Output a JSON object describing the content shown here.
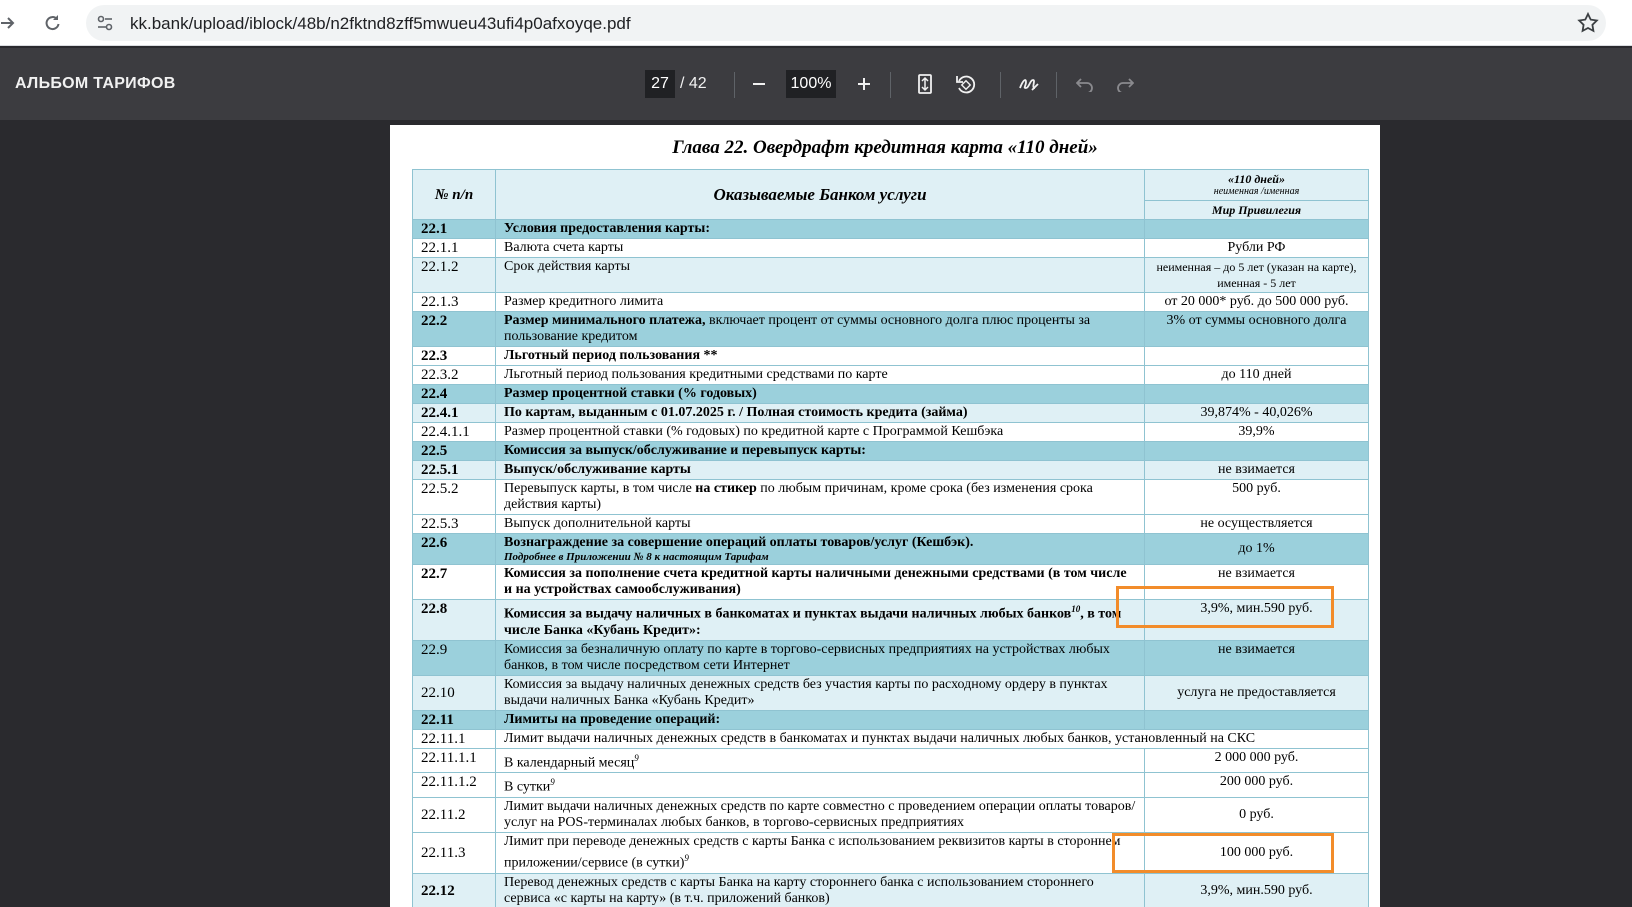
{
  "browser": {
    "url": "kk.bank/upload/iblock/48b/n2fktnd8zff5mwueu43ufi4p0afxoyqe.pdf"
  },
  "toolbar": {
    "title": "АЛЬБОМ ТАРИФОВ",
    "current_page": "27",
    "total_pages": "/ 42",
    "zoom": "100%",
    "zoom_out_icon": "minus-icon",
    "zoom_in_icon": "plus-icon",
    "fit_icon": "fit-page-icon",
    "rotate_icon": "rotate-icon",
    "annotate_icon": "annotate-icon",
    "undo_icon": "undo-icon",
    "redo_icon": "redo-icon"
  },
  "doc": {
    "chapter_title": "Глава 22. Овердрафт кредитная карта «110 дней»",
    "header": {
      "num": "№ п/п",
      "services": "Оказываемые Банком услуги",
      "product_top": "«110 дней»",
      "product_sub": "неименная /именная",
      "product_bottom": "Мир Привилегия"
    },
    "rows": [
      {
        "num": "22.1",
        "text": "Условия предоставления карты:",
        "value": "",
        "style": "sec"
      },
      {
        "num": "22.1.1",
        "text": "Валюта счета карты",
        "value": "Рубли РФ",
        "style": "plain"
      },
      {
        "num": "22.1.2",
        "text": "Срок действия карты",
        "value": "неименная – до 5 лет (указан на карте), именная - 5 лет",
        "style": "alt"
      },
      {
        "num": "22.1.3",
        "text": "Размер кредитного лимита",
        "value": "от 20 000* руб. до 500 000 руб.",
        "style": "plain"
      },
      {
        "num": "22.2",
        "text_bold": "Размер минимального платежа,",
        "text": " включает процент от суммы основного долга плюс проценты за пользование кредитом",
        "value": "3% от суммы основного долга",
        "style": "sec-mixed"
      },
      {
        "num": "22.3",
        "text": "Льготный период пользования **",
        "value": "",
        "style": "plain-bold"
      },
      {
        "num": "22.3.2",
        "text": "Льготный период пользования кредитными средствами по карте",
        "value": "до 110 дней",
        "style": "plain"
      },
      {
        "num": "22.4",
        "text": "Размер процентной ставки (% годовых)",
        "value": "",
        "style": "sec"
      },
      {
        "num": "22.4.1",
        "text": "По картам, выданным с 01.07.2025 г. / Полная стоимость кредита (займа)",
        "value": "39,874% - 40,026%",
        "style": "alt-bold"
      },
      {
        "num": "22.4.1.1",
        "text": "Размер процентной ставки (% годовых) по кредитной карте с Программой Кешбэка",
        "value": "39,9%",
        "style": "plain"
      },
      {
        "num": "22.5",
        "text": "Комиссия за выпуск/обслуживание и перевыпуск карты:",
        "value": "",
        "style": "sec"
      },
      {
        "num": "22.5.1",
        "text": "Выпуск/обслуживание  карты",
        "value": "не взимается",
        "style": "alt-bold"
      },
      {
        "num": "22.5.2",
        "text_pre": "Перевыпуск карты, в том числе ",
        "text_bold": "на стикер",
        "text": " по любым причинам, кроме срока (без изменения срока действия карты)",
        "value": "500 руб.",
        "style": "plain-mixed"
      },
      {
        "num": "22.5.3",
        "text": "Выпуск дополнительной карты",
        "value": "не осуществляется",
        "style": "plain"
      },
      {
        "num": "22.6",
        "text": "Вознаграждение за совершение операций оплаты товаров/услуг (Кешбэк).",
        "note": "Подробнее в Приложении № 8 к настоящим Тарифам",
        "value": "до 1%",
        "style": "sec-note"
      },
      {
        "num": "22.7",
        "text": "Комиссия за пополнение счета кредитной карты наличными денежными средствами (в том числе и на устройствах самообслуживания)",
        "value": "не взимается",
        "style": "plain-bold"
      },
      {
        "num": "22.8",
        "text": "Комиссия за выдачу наличных в банкоматах и пунктах выдачи наличных любых банков",
        "sup": "10",
        "text_after": ", в том числе Банка «Кубань Кредит»:",
        "value": "3,9%, мин.590 руб.",
        "style": "alt-bold-sup"
      },
      {
        "num": "22.9",
        "text": "Комиссия за безналичную оплату по карте в торгово-сервисных предприятиях  на  устройствах любых  банков, в том числе посредством сети Интернет",
        "value": "не взимается",
        "style": "sec-normal"
      },
      {
        "num": "22.10",
        "text": "Комиссия за выдачу наличных денежных средств без участия карты по расходному ордеру в пунктах выдачи наличных Банка «Кубань Кредит»",
        "value": "услуга не предоставляется",
        "style": "alt-mid"
      },
      {
        "num": "22.11",
        "text": "Лимиты на проведение операций:",
        "value": "",
        "style": "sec"
      },
      {
        "num": "22.11.1",
        "text": "Лимит выдачи наличных денежных средств в банкоматах и пунктах выдачи наличных любых банков, установленный на СКС",
        "value": "",
        "style": "span"
      },
      {
        "num": "22.11.1.1",
        "text": "В календарный месяц",
        "sup": "9",
        "value": "2 000 000 руб.",
        "style": "plain-sup"
      },
      {
        "num": "22.11.1.2",
        "text": "В сутки",
        "sup": "9",
        "value": "200 000 руб.",
        "style": "plain-sup"
      },
      {
        "num": "22.11.2",
        "text": "Лимит выдачи наличных денежных средств по карте совместно с проведением операции оплаты товаров/услуг на POS-терминалах любых банков, в торгово-сервисных предприятиях",
        "value": "0 руб.",
        "style": "plain-mid"
      },
      {
        "num": "22.11.3",
        "text": "Лимит при переводе денежных средств с карты Банка с использованием реквизитов карты в стороннем приложении/сервисе (в сутки)",
        "sup": "9",
        "value": "100 000 руб.",
        "style": "plain-sup-mid"
      },
      {
        "num": "22.12",
        "text": "Перевод денежных средств с карты Банка на карту стороннего банка с использованием стороннего сервиса «с карты на карту» (в т.ч. приложений банков)",
        "value": "3,9%, мин.590 руб.",
        "style": "alt-mid-numbold"
      }
    ]
  }
}
